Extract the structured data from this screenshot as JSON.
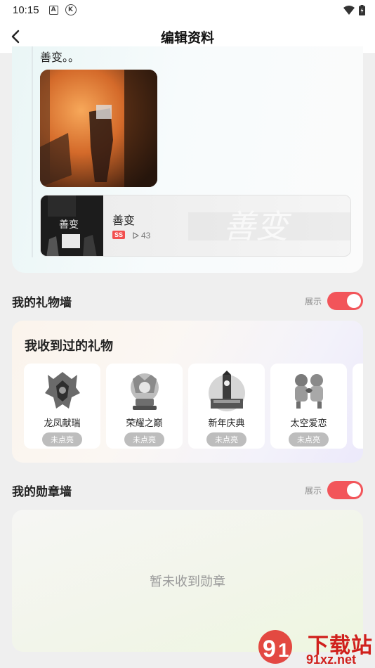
{
  "status_bar": {
    "time": "10:15",
    "icon_a": "A",
    "icon_k": "K"
  },
  "header": {
    "title": "编辑资料"
  },
  "moment": {
    "text": "善变。。",
    "music": {
      "title": "善变",
      "quality_tag": "SS",
      "play_count": "43",
      "cover_text": "善变",
      "art_text": "善变"
    }
  },
  "gift_section": {
    "title": "我的礼物墙",
    "toggle_label": "展示",
    "card_title": "我收到过的礼物",
    "gifts": [
      {
        "name": "龙凤献瑞",
        "status": "未点亮"
      },
      {
        "name": "荣耀之巅",
        "status": "未点亮"
      },
      {
        "name": "新年庆典",
        "status": "未点亮"
      },
      {
        "name": "太空爱恋",
        "status": "未点亮"
      }
    ]
  },
  "badge_section": {
    "title": "我的勋章墙",
    "toggle_label": "展示",
    "empty_text": "暂未收到勋章"
  },
  "watermark": {
    "text": "下载站",
    "url": "91xz.net"
  }
}
